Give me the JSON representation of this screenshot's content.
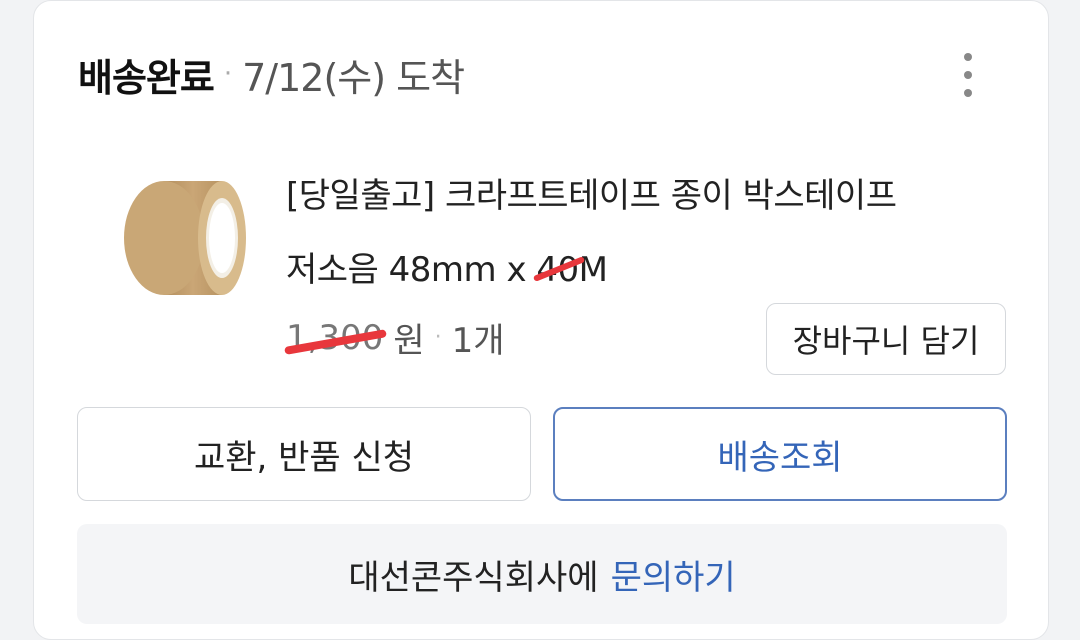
{
  "order": {
    "status": "배송완료",
    "separator": "·",
    "arrival": "7/12(수) 도착"
  },
  "menu_icon": "more-vertical-icon",
  "product": {
    "image": "kraft-tape-roll",
    "name_line1": "[당일출고] 크라프트테이프 종이 박스테이프",
    "name_line2_prefix": "저소음 48mm x ",
    "name_line2_struck": "40",
    "name_line2_suffix": "M",
    "price": "1,300",
    "currency": "원",
    "qty_separator": "·",
    "quantity": "1개"
  },
  "buttons": {
    "add_to_cart": "장바구니 담기",
    "exchange_return": "교환, 반품 신청",
    "track_delivery": "배송조회"
  },
  "inquiry": {
    "seller_text": "대선콘주식회사에",
    "link_text": "문의하기"
  },
  "colors": {
    "link_blue": "#3465b8",
    "strike_red": "#e8373c"
  }
}
